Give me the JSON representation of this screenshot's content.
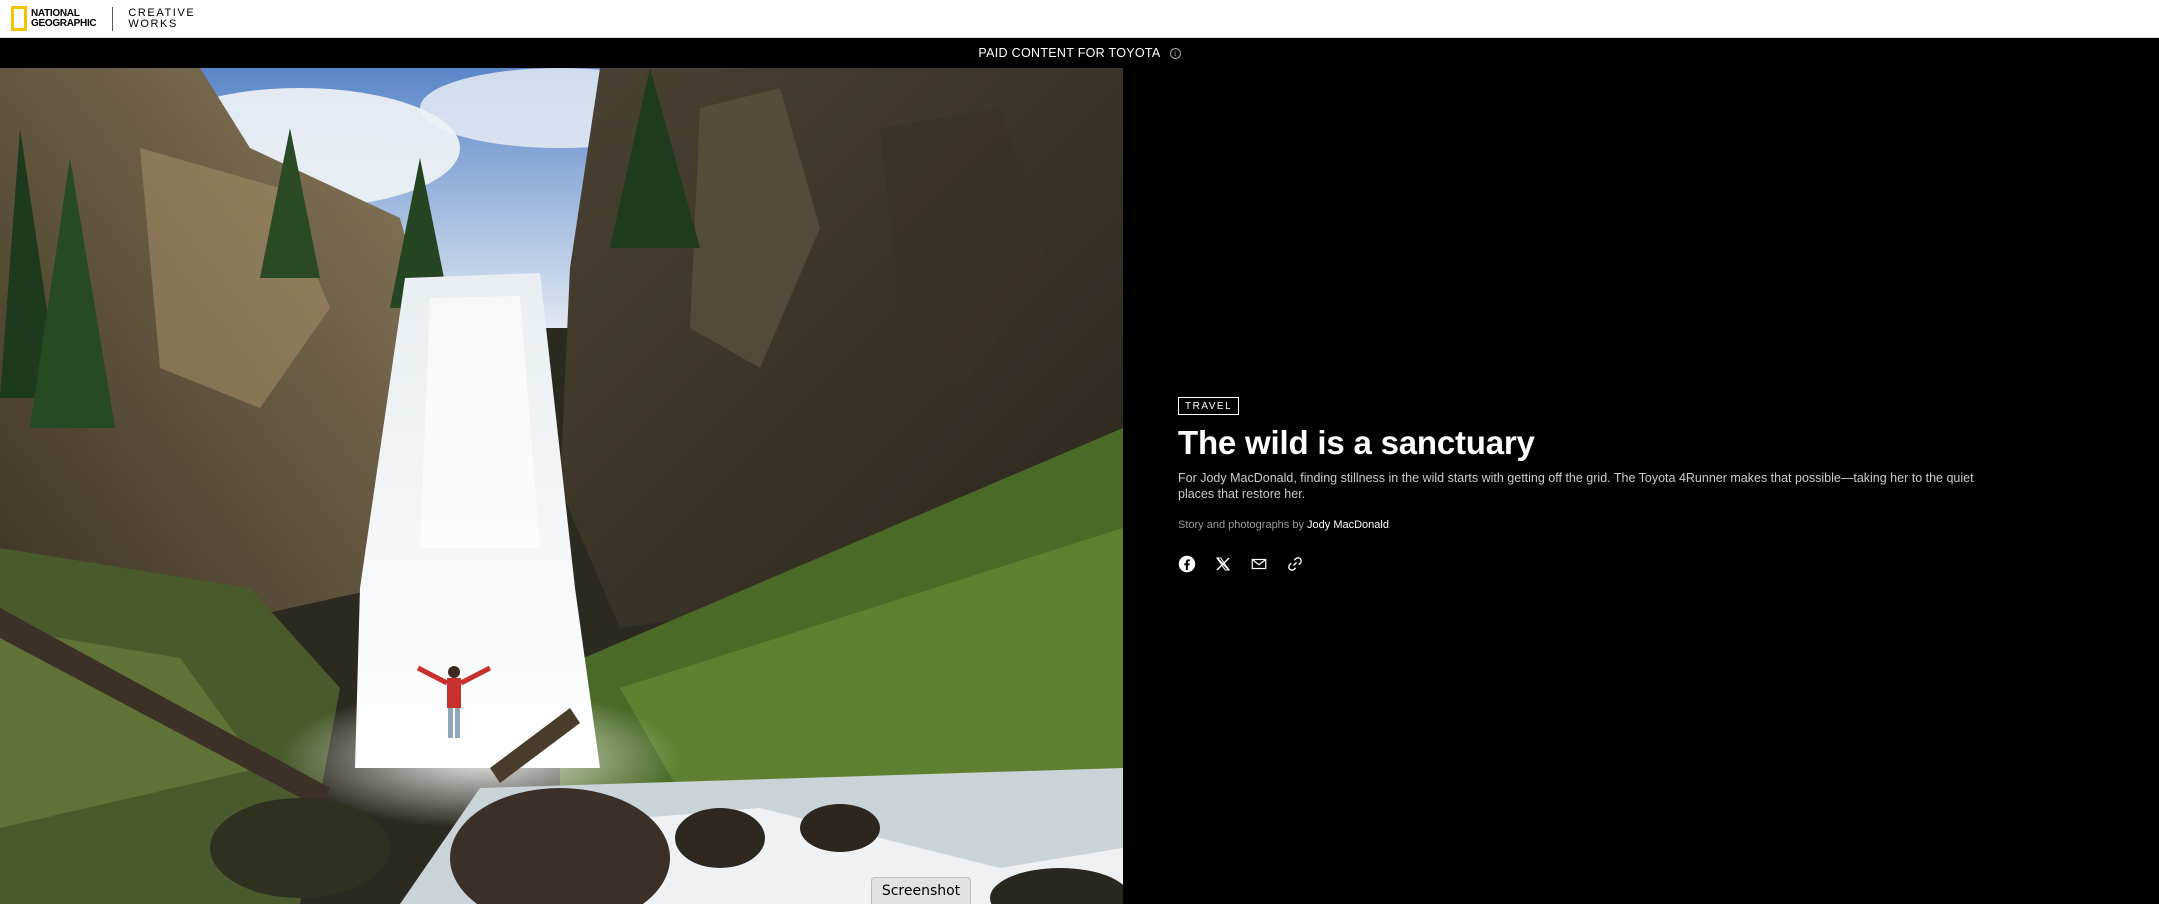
{
  "header": {
    "brand_line1": "NATIONAL",
    "brand_line2": "GEOGRAPHIC",
    "sub_line1": "CREATIVE",
    "sub_line2": "WORKS",
    "brand_color": "#F3C300"
  },
  "sponsor_bar": {
    "label": "PAID CONTENT FOR TOYOTA",
    "info_icon": "info-icon"
  },
  "hero": {
    "image": "waterfall-hiker-photo"
  },
  "article": {
    "category": "TRAVEL",
    "title": "The wild is a sanctuary",
    "dek": "For Jody MacDonald, finding stillness in the wild starts with getting off the grid. The Toyota 4Runner makes that possible—taking her to the quiet places that restore her.",
    "byline_prefix": "Story and photographs by ",
    "author": "Jody MacDonald"
  },
  "share": {
    "icons": [
      "facebook-icon",
      "x-icon",
      "email-icon",
      "link-icon"
    ]
  },
  "overlay": {
    "screenshot_label": "Screenshot"
  }
}
